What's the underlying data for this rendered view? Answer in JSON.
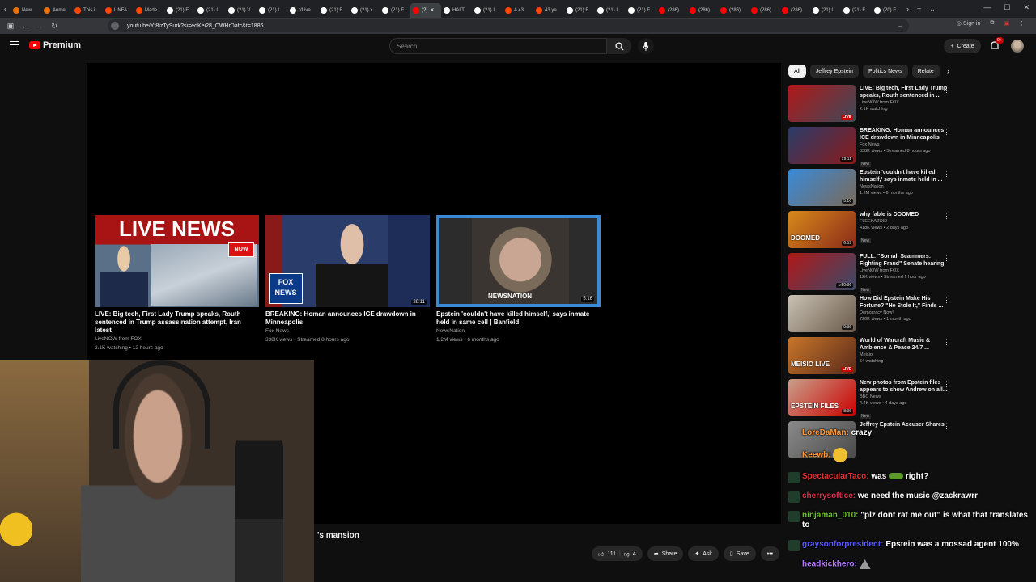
{
  "browser": {
    "tabs": [
      {
        "label": "New",
        "color": "#e8710a"
      },
      {
        "label": "Aume",
        "color": "#e8710a"
      },
      {
        "label": "This i",
        "color": "#ff4500"
      },
      {
        "label": "UNFA",
        "color": "#ff4500"
      },
      {
        "label": "Made",
        "color": "#ff4500"
      },
      {
        "label": "(21) F",
        "color": "#ffffff"
      },
      {
        "label": "(21) I",
        "color": "#ffffff"
      },
      {
        "label": "(21) V",
        "color": "#ffffff"
      },
      {
        "label": "(21) I",
        "color": "#ffffff"
      },
      {
        "label": "r/Live",
        "color": "#ffffff"
      },
      {
        "label": "(21) F",
        "color": "#ffffff"
      },
      {
        "label": "(21) x",
        "color": "#ffffff"
      },
      {
        "label": "(21) F",
        "color": "#ffffff"
      },
      {
        "label": "(2)",
        "color": "#ff0000",
        "active": true
      },
      {
        "label": "HALT",
        "color": "#ffffff"
      },
      {
        "label": "(21) I",
        "color": "#ffffff"
      },
      {
        "label": "A 43",
        "color": "#ff4500"
      },
      {
        "label": "43 ye",
        "color": "#ff4500"
      },
      {
        "label": "(21) F",
        "color": "#ffffff"
      },
      {
        "label": "(21) I",
        "color": "#ffffff"
      },
      {
        "label": "(21) F",
        "color": "#ffffff"
      },
      {
        "label": "(286)",
        "color": "#ff0000"
      },
      {
        "label": "(286)",
        "color": "#ff0000"
      },
      {
        "label": "(286)",
        "color": "#ff0000"
      },
      {
        "label": "(286)",
        "color": "#ff0000"
      },
      {
        "label": "(286)",
        "color": "#ff0000"
      },
      {
        "label": "(21) I",
        "color": "#ffffff"
      },
      {
        "label": "(21) F",
        "color": "#ffffff"
      },
      {
        "label": "(20) F",
        "color": "#ffffff"
      }
    ],
    "url": "youtu.be/Yf8izTySurk?si=edKei28_CWHrDafc&t=1886",
    "sign_in": "Sign in"
  },
  "youtube": {
    "brand": "Premium",
    "search_placeholder": "Search",
    "create_label": "Create",
    "notif_count": "9+",
    "end_cards": [
      {
        "title": "LIVE: Big tech, First Lady Trump speaks, Routh sentenced in Trump assassination attempt, Iran latest",
        "channel": "LiveNOW from FOX",
        "meta": "2.1K watching • 12 hours ago",
        "thumb_text": "LIVE NEWS"
      },
      {
        "title": "BREAKING: Homan announces ICE drawdown in Minneapolis",
        "channel": "Fox News",
        "meta": "338K views • Streamed 8 hours ago",
        "duration": "29:11"
      },
      {
        "title": "Epstein 'couldn't have killed himself,' says inmate held in same cell | Banfield",
        "channel": "NewsNation",
        "meta": "1.2M views • 6 months ago",
        "duration": "5:16"
      }
    ],
    "video_title_fragment": "'s mansion",
    "actions": {
      "likes": "111",
      "dislikes": "4",
      "share": "Share",
      "ask": "Ask",
      "save": "Save"
    },
    "chips": [
      "All",
      "Jeffrey Epstein",
      "Politics News",
      "Relate"
    ],
    "sidebar": [
      {
        "title": "LIVE: Big tech, First Lady Trump speaks, Routh sentenced in ...",
        "channel": "LiveNOW from FOX",
        "meta": "2.1K watching",
        "badge": "LIVE",
        "color1": "#b01818",
        "color2": "#3c4a5a"
      },
      {
        "title": "BREAKING: Homan announces ICE drawdown in Minneapolis",
        "channel": "Fox News",
        "meta": "338K views • Streamed 8 hours ago",
        "new": "New",
        "duration": "29:11",
        "color1": "#2a3d6a",
        "color2": "#8a1a1a"
      },
      {
        "title": "Epstein 'couldn't have killed himself,' says inmate held in ...",
        "channel": "NewsNation",
        "meta": "1.2M views • 6 months ago",
        "duration": "5:16",
        "color1": "#3a8ad8",
        "color2": "#7a6a5a"
      },
      {
        "title": "why fable is DOOMED",
        "channel": "FLEEKAZOID",
        "meta": "418K views • 2 days ago",
        "new": "New",
        "duration": "6:59",
        "color1": "#d88a1a",
        "color2": "#8a2a1a",
        "thumb_text": "DOOMED"
      },
      {
        "title": "FULL: \"Somali Scammers: Fighting Fraud\" Senate hearing",
        "channel": "LiveNOW from FOX",
        "meta": "12K views • Streamed 1 hour ago",
        "new": "New",
        "duration": "1:50:36",
        "color1": "#b01818",
        "color2": "#3a4a6a"
      },
      {
        "title": "How Did Epstein Make His Fortune? \"He Stole It,\" Finds ...",
        "channel": "Democracy Now!",
        "meta": "720K views • 1 month ago",
        "duration": "9:36",
        "color1": "#c9c1b3",
        "color2": "#6a5a4a"
      },
      {
        "title": "World of Warcraft Music & Ambience & Peace 24/7 ...",
        "channel": "Meisio",
        "meta": "54 watching",
        "badge": "LIVE",
        "color1": "#c8762a",
        "color2": "#5a2a1a",
        "thumb_text": "MEISIO LIVE"
      },
      {
        "title": "New photos from Epstein files appears to show Andrew on all...",
        "channel": "BBC News",
        "meta": "4.4K views • 4 days ago",
        "new": "New",
        "duration": "8:36",
        "color1": "#c8a08a",
        "color2": "#cc0000",
        "thumb_text": "EPSTEIN FILES"
      },
      {
        "title": "Jeffrey Epstein Accuser Shares",
        "channel": "",
        "meta": "",
        "color1": "#8a8a8a",
        "color2": "#4a4a4a"
      }
    ]
  },
  "chat": [
    {
      "user": "LoreDaMan:",
      "msg": "crazy",
      "color": "#ff9a3c"
    },
    {
      "user": "Keewb:",
      "msg": "",
      "color": "#ff9a3c"
    },
    {
      "user": "SpectacularTaco:",
      "msg": "was",
      "msg2": "right?",
      "color": "#e03030"
    },
    {
      "user": "cherrysoftice:",
      "msg": "we need the music @zackrawrr",
      "color": "#e03050"
    },
    {
      "user": "ninjaman_010:",
      "msg": "\"plz dont rat me out\" is what that translates to",
      "color": "#6cbf2c"
    },
    {
      "user": "graysonforpresident:",
      "msg": "Epstein was a mossad agent 100%",
      "color": "#5a5aff"
    },
    {
      "user": "headkickhero:",
      "msg": "",
      "color": "#b67cff"
    }
  ]
}
